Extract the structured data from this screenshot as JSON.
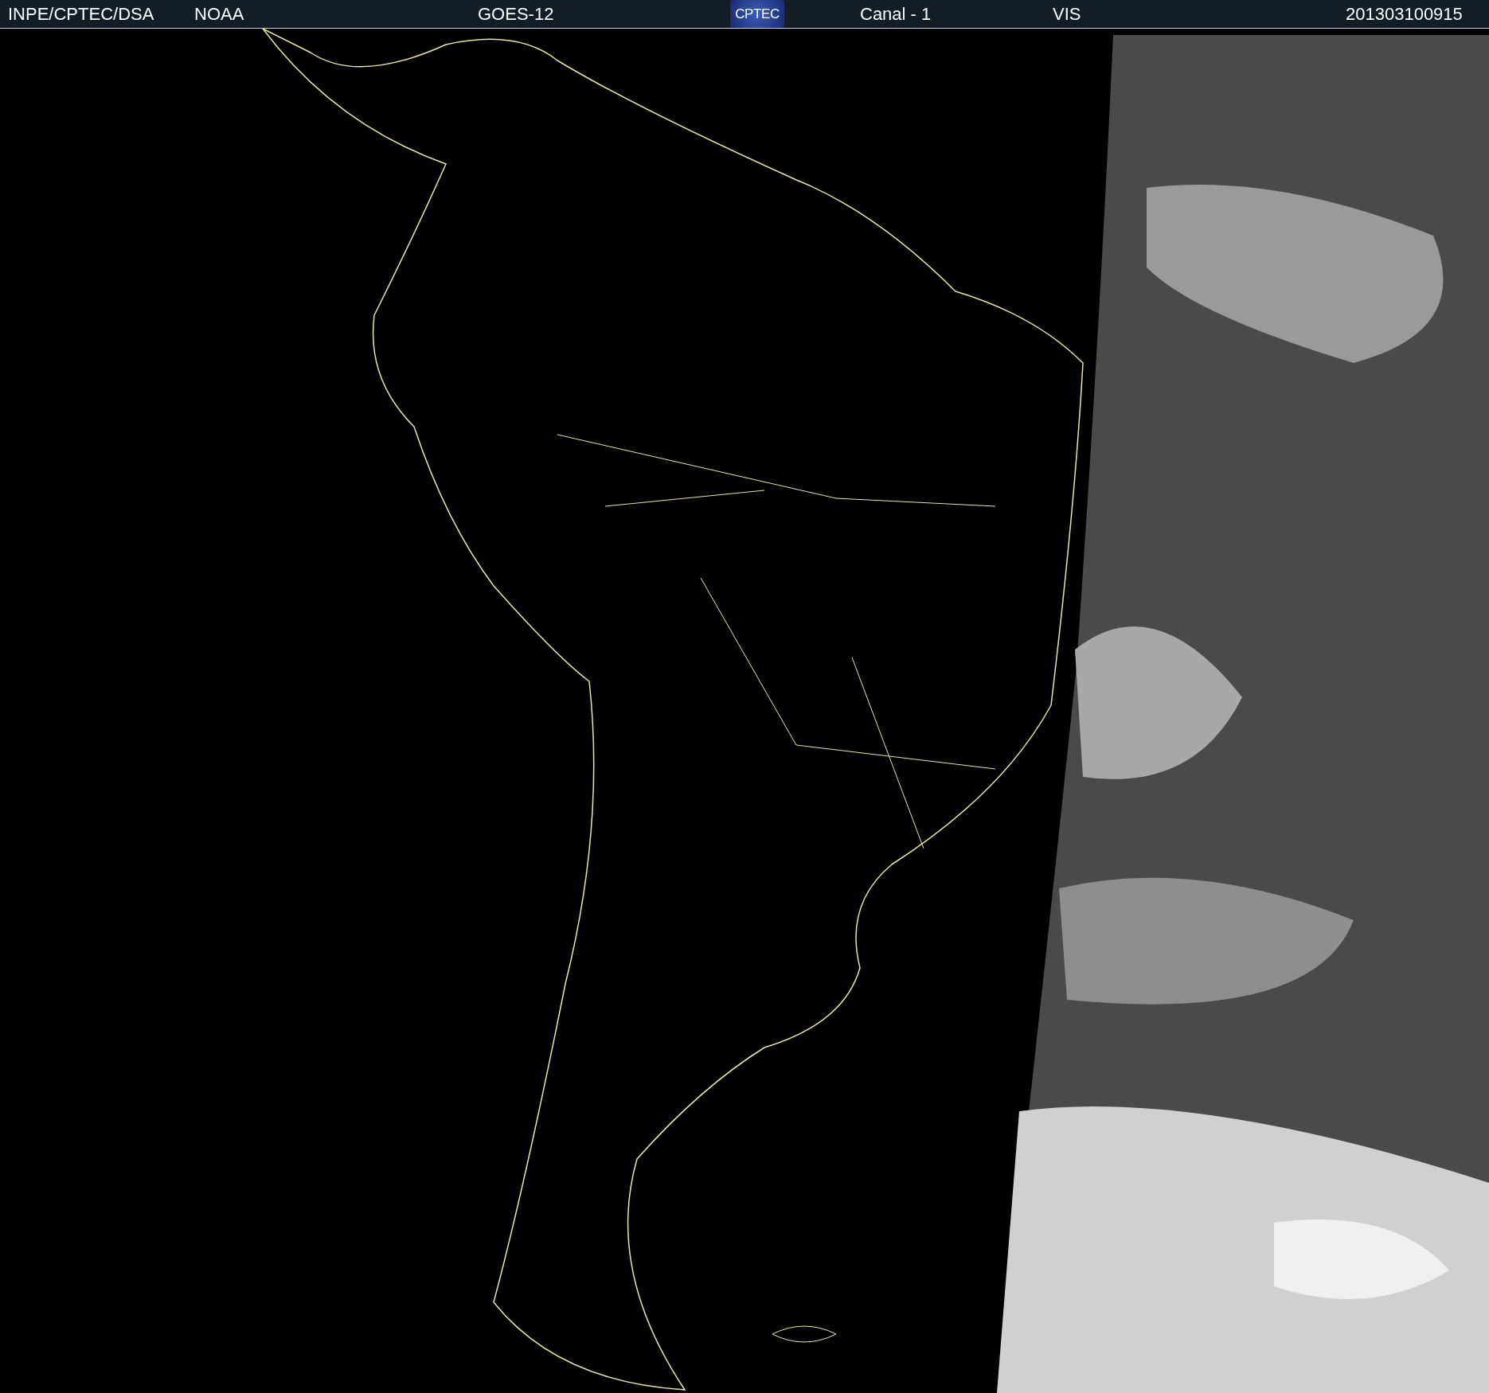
{
  "header": {
    "source": "INPE/CPTEC/DSA",
    "agency": "NOAA",
    "satellite": "GOES-12",
    "logo_text": "CPTEC",
    "channel": "Canal - 1",
    "band": "VIS",
    "timestamp": "201303100915"
  }
}
